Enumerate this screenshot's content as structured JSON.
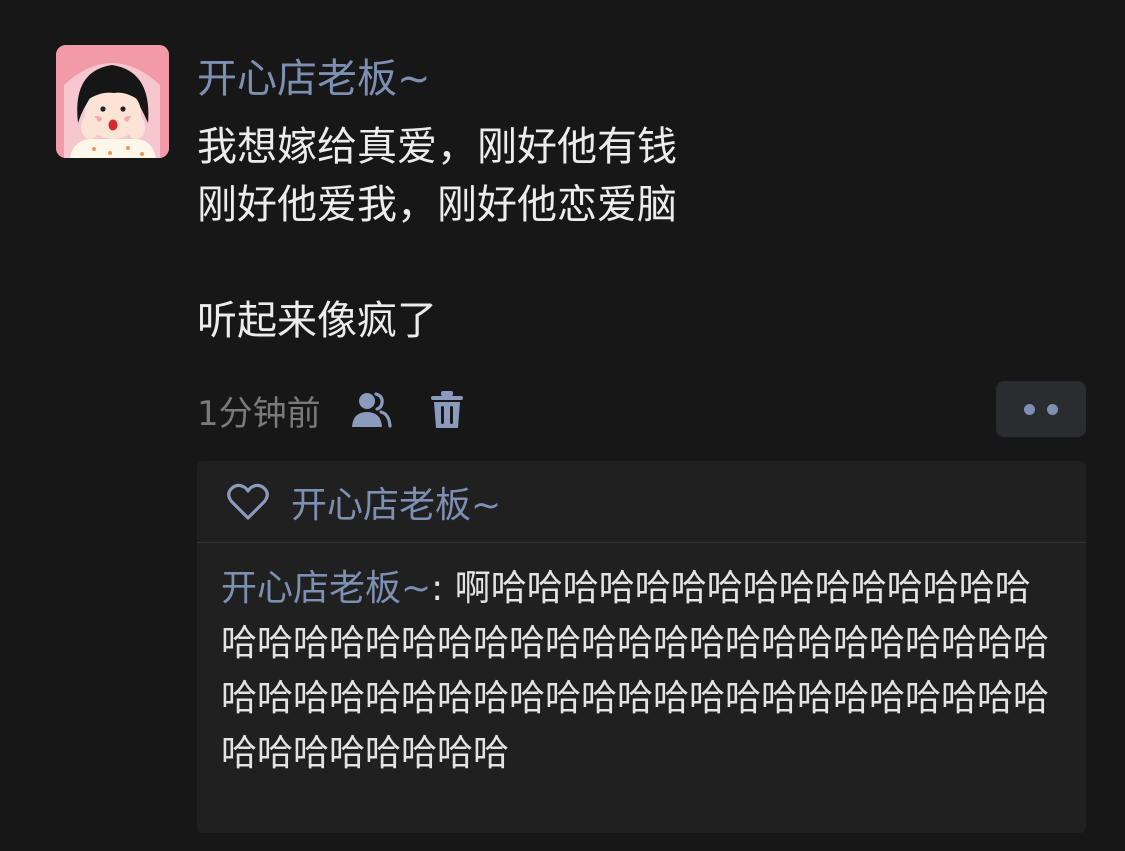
{
  "post": {
    "author": "开心店老板~",
    "lines": [
      "我想嫁给真爱，刚好他有钱",
      "刚好他爱我，刚好他恋爱脑",
      "听起来像疯了"
    ],
    "time": "1分钟前"
  },
  "icons": {
    "avatar": "avatar-cartoon-girl",
    "visibility": "person-icon",
    "delete": "trash-icon",
    "more": "more-dots-icon",
    "like": "heart-outline-icon"
  },
  "likes": {
    "names": "开心店老板~"
  },
  "comments": [
    {
      "author": "开心店老板~",
      "separator": ": ",
      "text": "啊哈哈哈哈哈哈哈哈哈哈哈哈哈哈哈哈哈哈哈哈哈哈哈哈哈哈哈哈哈哈哈哈哈哈哈哈哈哈哈哈哈哈哈哈哈哈哈哈哈哈哈哈哈哈哈哈哈哈哈哈哈哈哈哈哈哈哈哈哈"
    }
  ],
  "colors": {
    "background": "#171717",
    "name_link": "#7d90b3",
    "panel": "#202020"
  }
}
